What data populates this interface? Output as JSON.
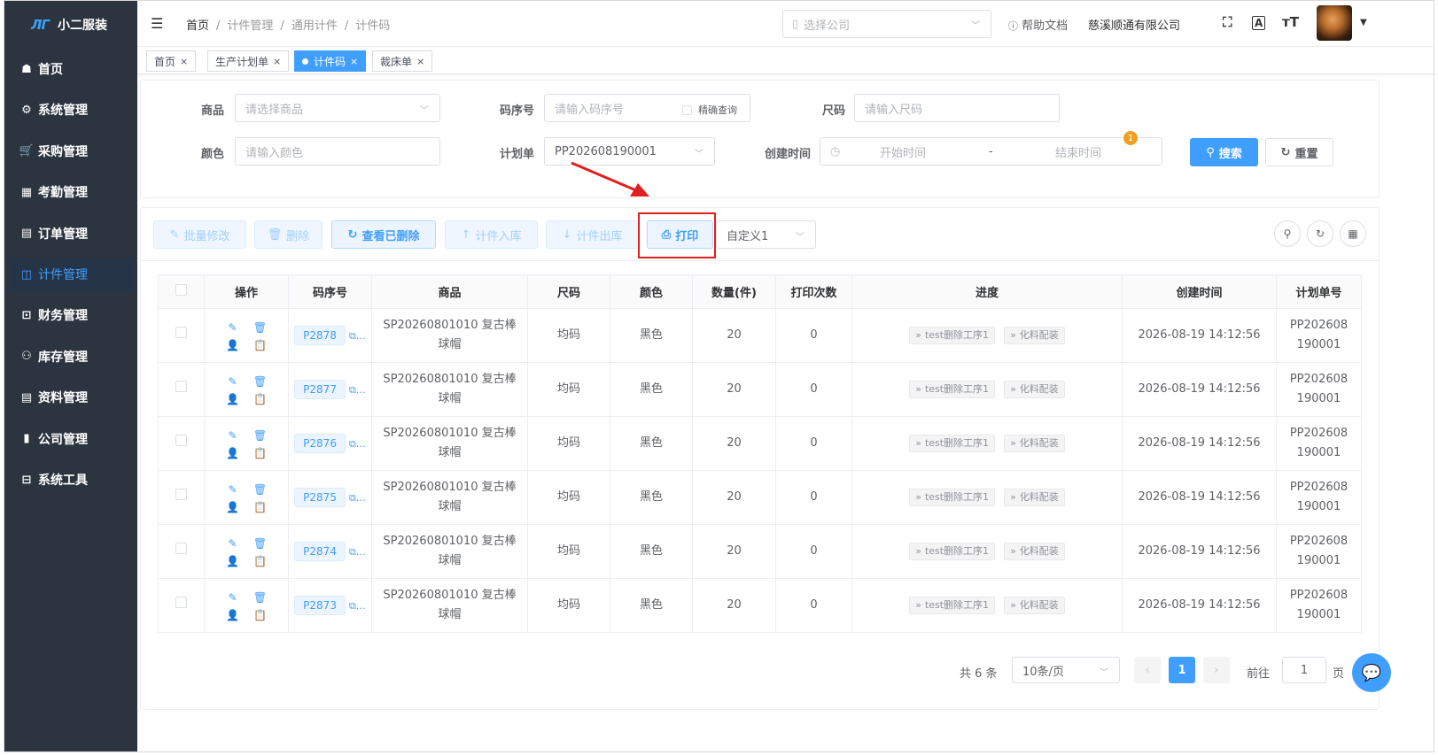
{
  "app": {
    "logo_mark": "ЛГ",
    "logo_text": "小二服装"
  },
  "sidebar": {
    "items": [
      {
        "label": "首页",
        "icon": "dashboard-icon",
        "glyph": "☗"
      },
      {
        "label": "系统管理",
        "icon": "gear-icon",
        "glyph": "⚙"
      },
      {
        "label": "采购管理",
        "icon": "cart-icon",
        "glyph": "🛒"
      },
      {
        "label": "考勤管理",
        "icon": "grid-icon",
        "glyph": "▦"
      },
      {
        "label": "订单管理",
        "icon": "order-icon",
        "glyph": "▤"
      },
      {
        "label": "计件管理",
        "icon": "book-icon",
        "glyph": "◫"
      },
      {
        "label": "财务管理",
        "icon": "chart-board-icon",
        "glyph": "⊡"
      },
      {
        "label": "库存管理",
        "icon": "person-icon",
        "glyph": "⚇"
      },
      {
        "label": "资料管理",
        "icon": "document-icon",
        "glyph": "▤"
      },
      {
        "label": "公司管理",
        "icon": "bar-chart-icon",
        "glyph": "▮"
      },
      {
        "label": "系统工具",
        "icon": "toolbox-icon",
        "glyph": "⊟"
      }
    ],
    "active": "计件管理"
  },
  "header": {
    "breadcrumb": [
      "首页",
      "计件管理",
      "通用计件",
      "计件码"
    ],
    "company_placeholder": "选择公司",
    "help": "帮助文档",
    "company_name": "慈溪顺通有限公司"
  },
  "tabs": [
    {
      "label": "首页"
    },
    {
      "label": "生产计划单"
    },
    {
      "label": "计件码",
      "active": true
    },
    {
      "label": "裁床单"
    }
  ],
  "filters": {
    "product_label": "商品",
    "product_placeholder": "请选择商品",
    "code_label": "码序号",
    "code_placeholder": "请输入码序号",
    "exact_label": "精确查询",
    "size_label": "尺码",
    "size_placeholder": "请输入尺码",
    "color_label": "颜色",
    "color_placeholder": "请输入颜色",
    "plan_label": "计划单",
    "plan_value": "PP202608190001",
    "time_label": "创建时间",
    "start_placeholder": "开始时间",
    "dash": "-",
    "end_placeholder": "结束时间",
    "search": "搜索",
    "search_badge": "1",
    "reset": "重置"
  },
  "toolbar": {
    "batch_edit": "批量修改",
    "delete": "删除",
    "view_deleted": "查看已删除",
    "stock_in": "计件入库",
    "stock_out": "计件出库",
    "print": "打印",
    "template": "自定义1"
  },
  "table": {
    "headers": [
      "操作",
      "码序号",
      "商品",
      "尺码",
      "颜色",
      "数量(件)",
      "打印次数",
      "进度",
      "创建时间",
      "计划单号"
    ],
    "rows": [
      {
        "code": "P2878",
        "product_1": "SP20260801010 复古棒",
        "product_2": "球帽",
        "size": "均码",
        "color": "黑色",
        "qty": "20",
        "prints": "0",
        "step1": "test删除工序1",
        "step2": "化料配装",
        "created": "2026-08-19 14:12:56",
        "plan_1": "PP202608",
        "plan_2": "190001"
      },
      {
        "code": "P2877",
        "product_1": "SP20260801010 复古棒",
        "product_2": "球帽",
        "size": "均码",
        "color": "黑色",
        "qty": "20",
        "prints": "0",
        "step1": "test删除工序1",
        "step2": "化料配装",
        "created": "2026-08-19 14:12:56",
        "plan_1": "PP202608",
        "plan_2": "190001"
      },
      {
        "code": "P2876",
        "product_1": "SP20260801010 复古棒",
        "product_2": "球帽",
        "size": "均码",
        "color": "黑色",
        "qty": "20",
        "prints": "0",
        "step1": "test删除工序1",
        "step2": "化料配装",
        "created": "2026-08-19 14:12:56",
        "plan_1": "PP202608",
        "plan_2": "190001"
      },
      {
        "code": "P2875",
        "product_1": "SP20260801010 复古棒",
        "product_2": "球帽",
        "size": "均码",
        "color": "黑色",
        "qty": "20",
        "prints": "0",
        "step1": "test删除工序1",
        "step2": "化料配装",
        "created": "2026-08-19 14:12:56",
        "plan_1": "PP202608",
        "plan_2": "190001"
      },
      {
        "code": "P2874",
        "product_1": "SP20260801010 复古棒",
        "product_2": "球帽",
        "size": "均码",
        "color": "黑色",
        "qty": "20",
        "prints": "0",
        "step1": "test删除工序1",
        "step2": "化料配装",
        "created": "2026-08-19 14:12:56",
        "plan_1": "PP202608",
        "plan_2": "190001"
      },
      {
        "code": "P2873",
        "product_1": "SP20260801010 复古棒",
        "product_2": "球帽",
        "size": "均码",
        "color": "黑色",
        "qty": "20",
        "prints": "0",
        "step1": "test删除工序1",
        "step2": "化料配装",
        "created": "2026-08-19 14:12:56",
        "plan_1": "PP202608",
        "plan_2": "190001"
      }
    ]
  },
  "pagination": {
    "total": "共 6 条",
    "page_size": "10条/页",
    "current": "1",
    "goto_label": "前往",
    "goto_value": "1",
    "page_unit": "页"
  },
  "colors": {
    "sidebar_bg": "#2c3440",
    "primary": "#409eff",
    "highlight": "#e02020",
    "badge": "#f0a020"
  }
}
